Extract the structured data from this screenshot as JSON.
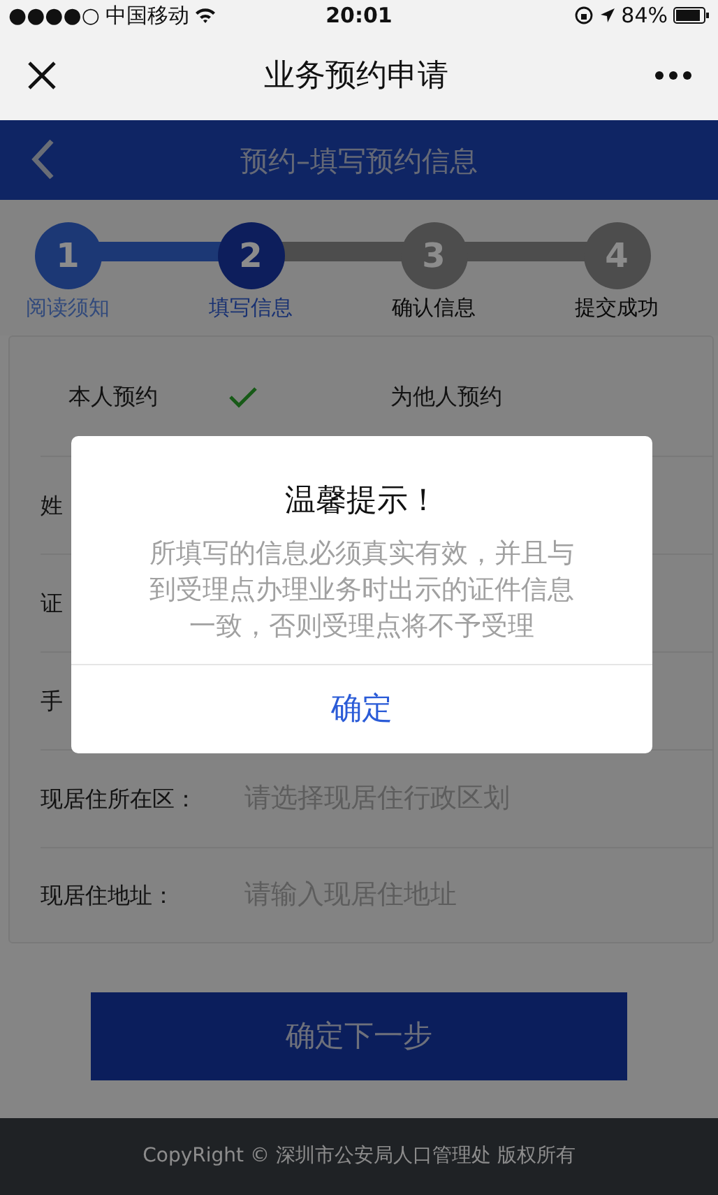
{
  "status_bar": {
    "signal": "●●●●○",
    "carrier": "中国移动",
    "time": "20:01",
    "battery": "84%"
  },
  "nav_bar": {
    "title": "业务预约申请"
  },
  "header": {
    "title": "预约–填写预约信息"
  },
  "steps": [
    {
      "number": "1",
      "label": "阅读须知",
      "completed": true,
      "current": false
    },
    {
      "number": "2",
      "label": "填写信息",
      "completed": false,
      "current": true
    },
    {
      "number": "3",
      "label": "确认信息",
      "completed": false,
      "current": false
    },
    {
      "number": "4",
      "label": "提交成功",
      "completed": false,
      "current": false
    }
  ],
  "appointment_options": [
    {
      "label": "本人预约",
      "selected": true
    },
    {
      "label": "为他人预约",
      "selected": false
    }
  ],
  "form_rows": [
    {
      "label": "姓"
    },
    {
      "label": "证"
    },
    {
      "label": "手"
    },
    {
      "label": "现居住所在区：",
      "placeholder": "请选择现居住行政区划"
    },
    {
      "label": "现居住地址：",
      "placeholder": "请输入现居住地址"
    }
  ],
  "next_button": "确定下一步",
  "footer": "CopyRight © 深圳市公安局人口管理处 版权所有",
  "dialog": {
    "title": "温馨提示！",
    "message": "所填写的信息必须真实有效，并且与到受理点办理业务时出示的证件信息一致，否则受理点将不予受理",
    "button": "确定"
  }
}
